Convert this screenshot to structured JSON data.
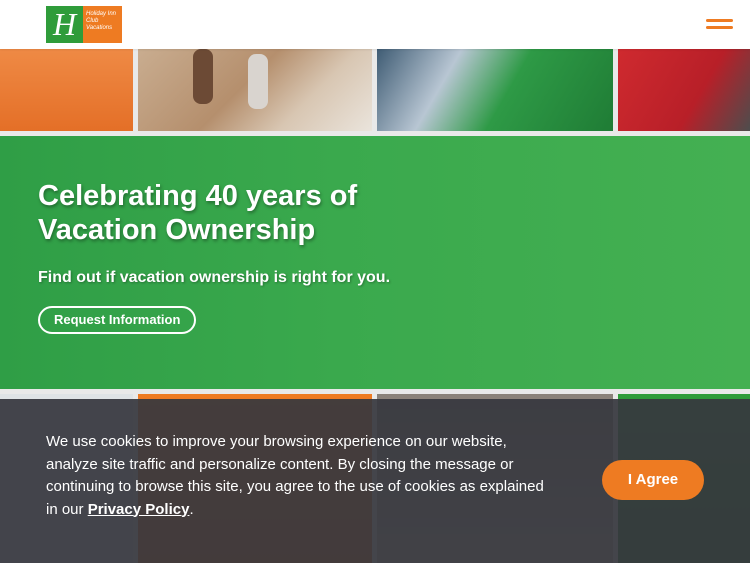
{
  "header": {
    "logo": {
      "mark": "H",
      "lines": [
        "Holiday Inn",
        "Club",
        "Vacations"
      ]
    },
    "menu_icon": "hamburger-menu-icon"
  },
  "hero": {
    "title": "Celebrating 40 years of Vacation Ownership",
    "subtitle": "Find out if vacation ownership is right for you.",
    "cta_label": "Request Information"
  },
  "cookie_banner": {
    "text": "We use cookies to improve your browsing experience on our website, analyze site traffic and personalize content. By closing the message or continuing to browse this site, you agree to the use of cookies as explained in our",
    "link_label": "Privacy Policy",
    "suffix": ".",
    "agree_label": "I Agree"
  },
  "colors": {
    "brand_green": "#2f9c3a",
    "brand_orange": "#ee7b22",
    "banner_bg": "#37383e"
  }
}
